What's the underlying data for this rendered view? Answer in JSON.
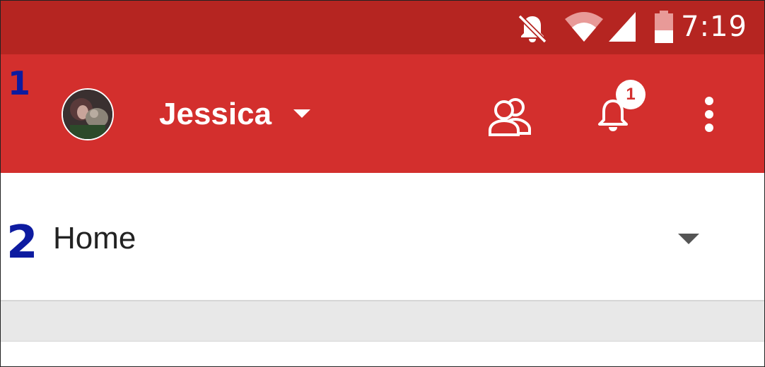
{
  "status_bar": {
    "time": "7:19",
    "icons": [
      "bell-off-icon",
      "wifi-icon",
      "signal-icon",
      "battery-icon"
    ],
    "background": "#b52521"
  },
  "app_bar": {
    "account_name": "Jessica",
    "notification_count": "1",
    "icons": [
      "avatar",
      "dropdown-caret-icon",
      "people-icon",
      "bell-icon",
      "more-vert-icon"
    ],
    "background": "#d32f2d"
  },
  "section_selector": {
    "label": "Home",
    "icon": "dropdown-caret-icon"
  },
  "annotations": {
    "first": "1",
    "second": "2",
    "color": "#0d1ba0"
  }
}
